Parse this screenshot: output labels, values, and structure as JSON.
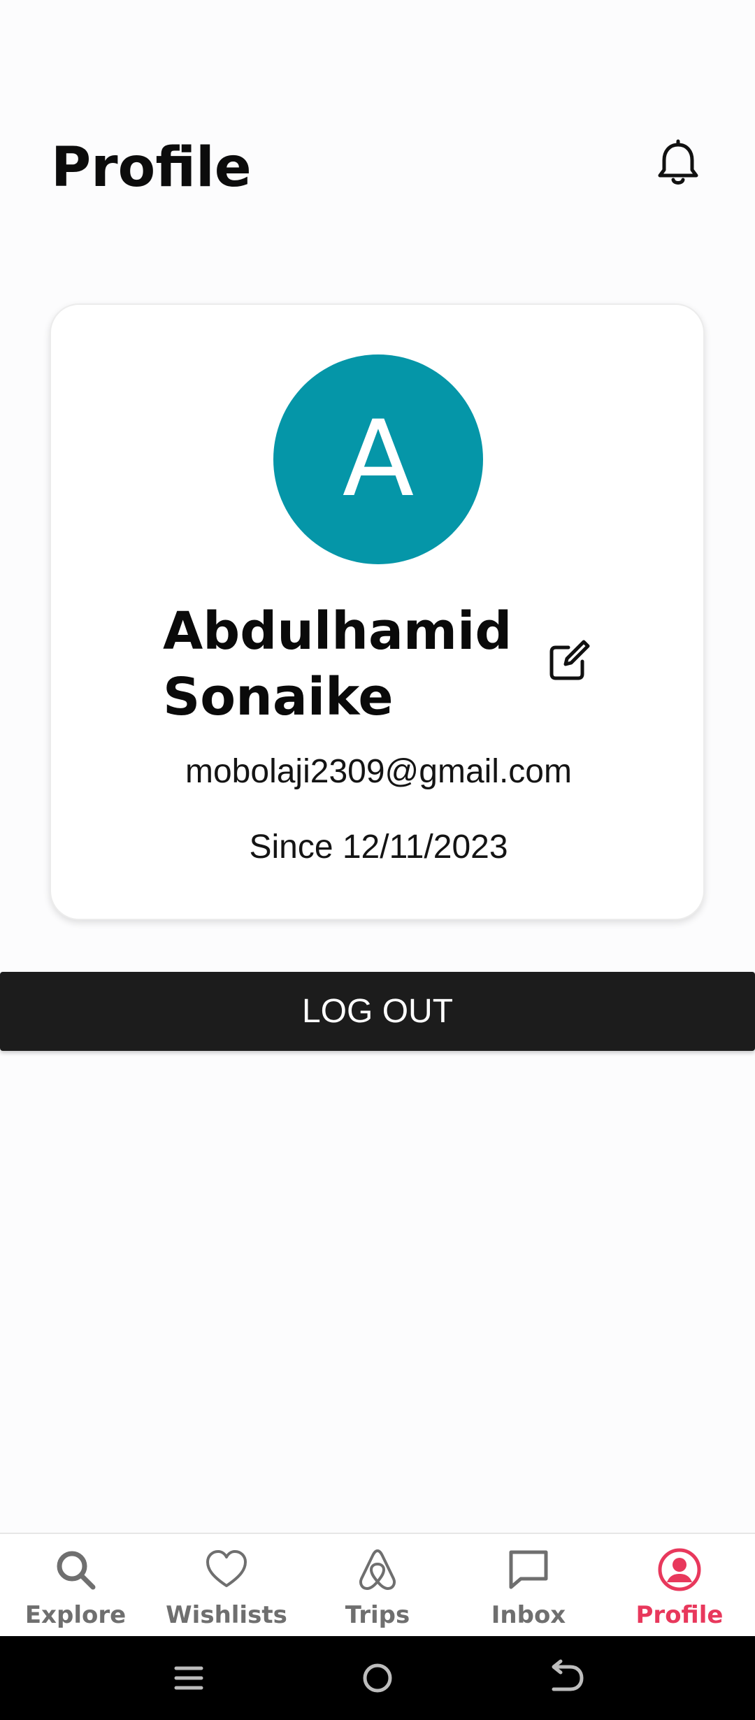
{
  "header": {
    "title": "Profile",
    "notification_icon": "bell-icon"
  },
  "profile": {
    "avatar_initial": "A",
    "avatar_color": "#0596a8",
    "name": "Abdulhamid Sonaike",
    "email": "mobolaji2309@gmail.com",
    "since": "Since 12/11/2023",
    "edit_icon": "edit-icon"
  },
  "actions": {
    "logout_label": "LOG OUT"
  },
  "tabbar": {
    "active_color": "#e8385c",
    "items": [
      {
        "label": "Explore",
        "icon": "search-icon"
      },
      {
        "label": "Wishlists",
        "icon": "heart-icon"
      },
      {
        "label": "Trips",
        "icon": "airbnb-icon"
      },
      {
        "label": "Inbox",
        "icon": "message-icon"
      },
      {
        "label": "Profile",
        "icon": "user-circle-icon",
        "active": true
      }
    ]
  },
  "system_nav": {
    "icons": [
      "recents-icon",
      "home-icon",
      "back-icon"
    ]
  }
}
